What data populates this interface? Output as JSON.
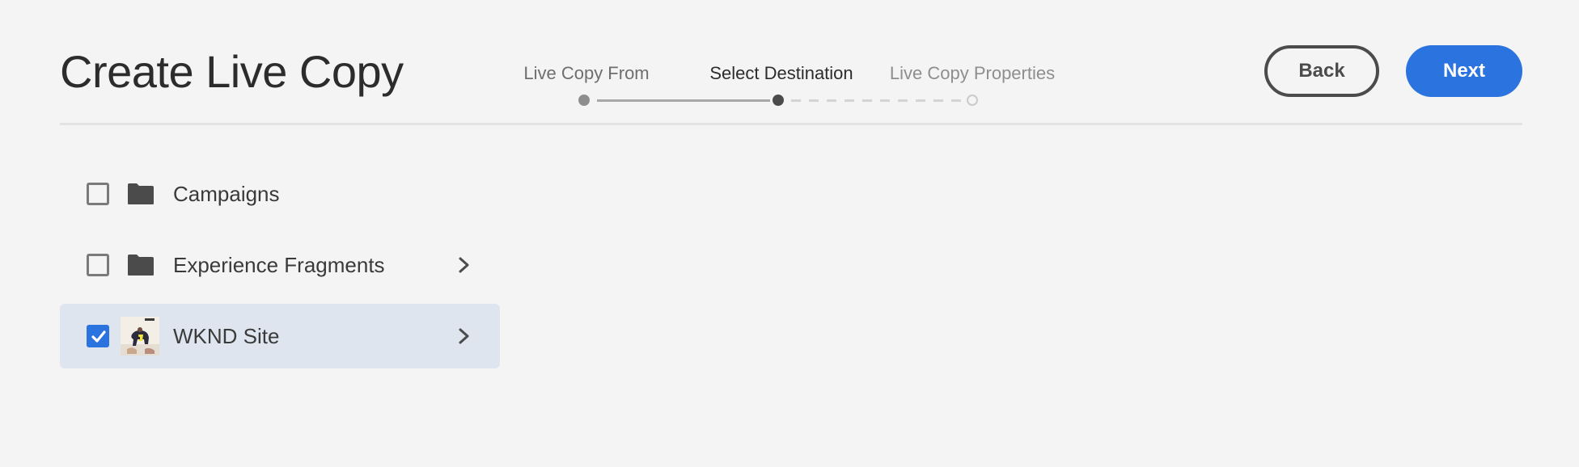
{
  "header": {
    "title": "Create Live Copy"
  },
  "stepper": {
    "steps": [
      {
        "label": "Live Copy From",
        "state": "done"
      },
      {
        "label": "Select Destination",
        "state": "current"
      },
      {
        "label": "Live Copy Properties",
        "state": "future"
      }
    ]
  },
  "actions": {
    "back_label": "Back",
    "next_label": "Next"
  },
  "colors": {
    "accent": "#2b73de",
    "background": "#f4f4f4",
    "selected_row": "#dfe5ef"
  },
  "list": {
    "items": [
      {
        "label": "Campaigns",
        "icon": "folder-icon",
        "checked": false,
        "has_children": false
      },
      {
        "label": "Experience Fragments",
        "icon": "folder-icon",
        "checked": false,
        "has_children": true
      },
      {
        "label": "WKND Site",
        "icon": "site-thumbnail",
        "checked": true,
        "has_children": true
      }
    ]
  }
}
